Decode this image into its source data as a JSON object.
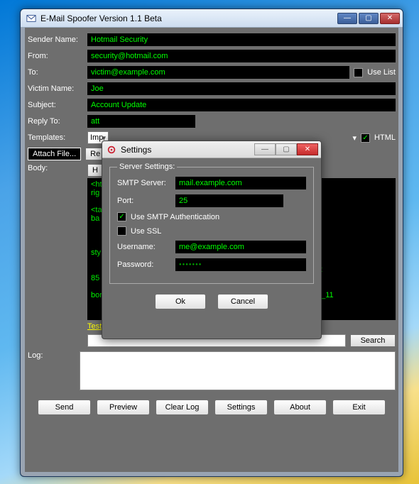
{
  "main": {
    "title": "E-Mail Spoofer Version 1.1 Beta",
    "labels": {
      "senderName": "Sender Name:",
      "from": "From:",
      "to": "To:",
      "useList": "Use List",
      "victimName": "Victim Name:",
      "subject": "Subject:",
      "replyTo": "Reply To:",
      "templates": "Templates:",
      "html": "HTML",
      "attachFile": "Attach File...",
      "remove": "Re",
      "htmlBtn": "H",
      "body": "Body:",
      "testSpam": "Test Spam Score",
      "search": "Search",
      "log": "Log:"
    },
    "values": {
      "senderName": "Hotmail Security",
      "from": "security@hotmail.com",
      "to": "victim@example.com",
      "victimName": "Joe",
      "subject": "Account Update",
      "replyTo": "att",
      "template": "Imp",
      "body": "<ht\nrig\n\n<ta                                                                                              x;\nba\n                                                                                         > </td>\n\n                                                                                         0\"\nsty\n\n                                                                                         om; height:\n85\n\nborder=\"0\" src=\"http://ads1.msn.com/ads/pronws/CIO/HMML/2010_11",
      "searchInput": "",
      "log": ""
    },
    "buttons": {
      "send": "Send",
      "preview": "Preview",
      "clearLog": "Clear Log",
      "settings": "Settings",
      "about": "About",
      "exit": "Exit"
    }
  },
  "dialog": {
    "title": "Settings",
    "groupTitle": "Server Settings:",
    "labels": {
      "smtp": "SMTP Server:",
      "port": "Port:",
      "useAuth": "Use SMTP Authentication",
      "useSSL": "Use SSL",
      "username": "Username:",
      "password": "Password:"
    },
    "values": {
      "smtp": "mail.example.com",
      "port": "25",
      "username": "me@example.com",
      "password": "●●●●●●●"
    },
    "buttons": {
      "ok": "Ok",
      "cancel": "Cancel"
    }
  }
}
